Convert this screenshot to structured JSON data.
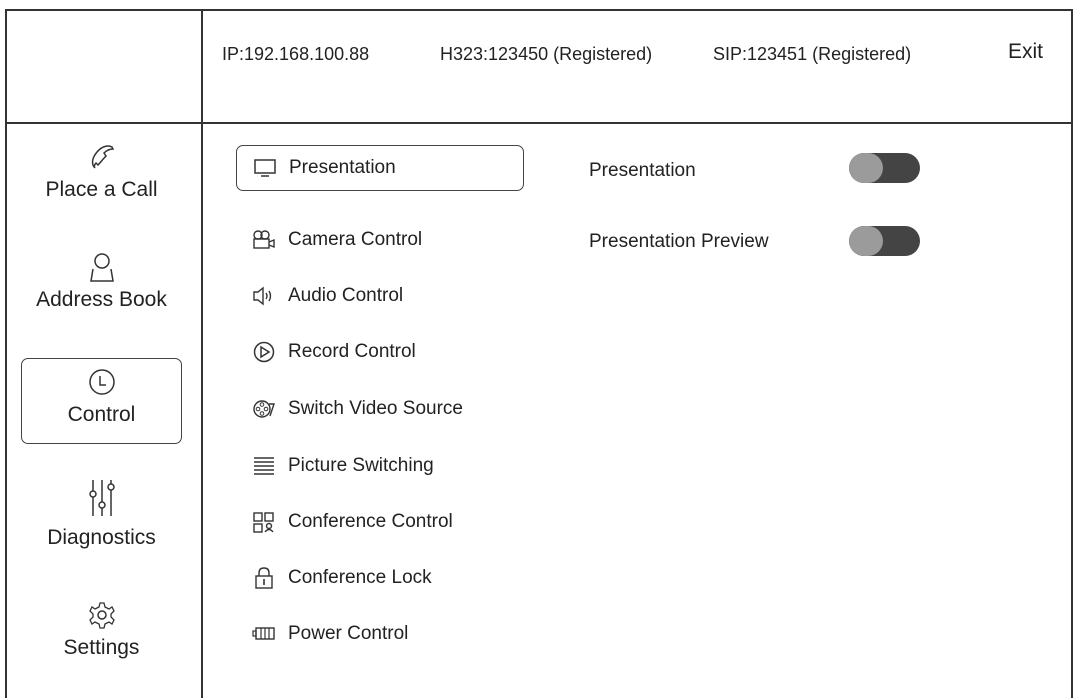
{
  "status_bar": {
    "ip": "IP:192.168.100.88",
    "h323": "H323:123450 (Registered)",
    "sip": "SIP:123451 (Registered)",
    "exit_label": "Exit"
  },
  "sidebar": {
    "items": [
      {
        "label": "Place a Call",
        "icon": "phone-icon"
      },
      {
        "label": "Address Book",
        "icon": "person-icon"
      },
      {
        "label": "Control",
        "icon": "clock-icon",
        "active": true
      },
      {
        "label": "Diagnostics",
        "icon": "sliders-icon"
      },
      {
        "label": "Settings",
        "icon": "gear-icon"
      }
    ]
  },
  "menu": {
    "items": [
      {
        "label": "Presentation",
        "icon": "monitor-icon",
        "active": true
      },
      {
        "label": "Camera Control",
        "icon": "camera-icon"
      },
      {
        "label": "Audio Control",
        "icon": "speaker-icon"
      },
      {
        "label": "Record Control",
        "icon": "play-circle-icon"
      },
      {
        "label": "Switch Video Source",
        "icon": "film-reel-icon"
      },
      {
        "label": "Picture Switching",
        "icon": "list-lines-icon"
      },
      {
        "label": "Conference Control",
        "icon": "grid-person-icon"
      },
      {
        "label": "Conference Lock",
        "icon": "lock-icon"
      },
      {
        "label": "Power Control",
        "icon": "battery-icon"
      }
    ]
  },
  "settings": [
    {
      "label": "Presentation",
      "enabled": false
    },
    {
      "label": "Presentation Preview",
      "enabled": false
    }
  ],
  "colors": {
    "toggle_track": "#444444",
    "toggle_knob": "#9b9b9b",
    "border": "#333333"
  }
}
